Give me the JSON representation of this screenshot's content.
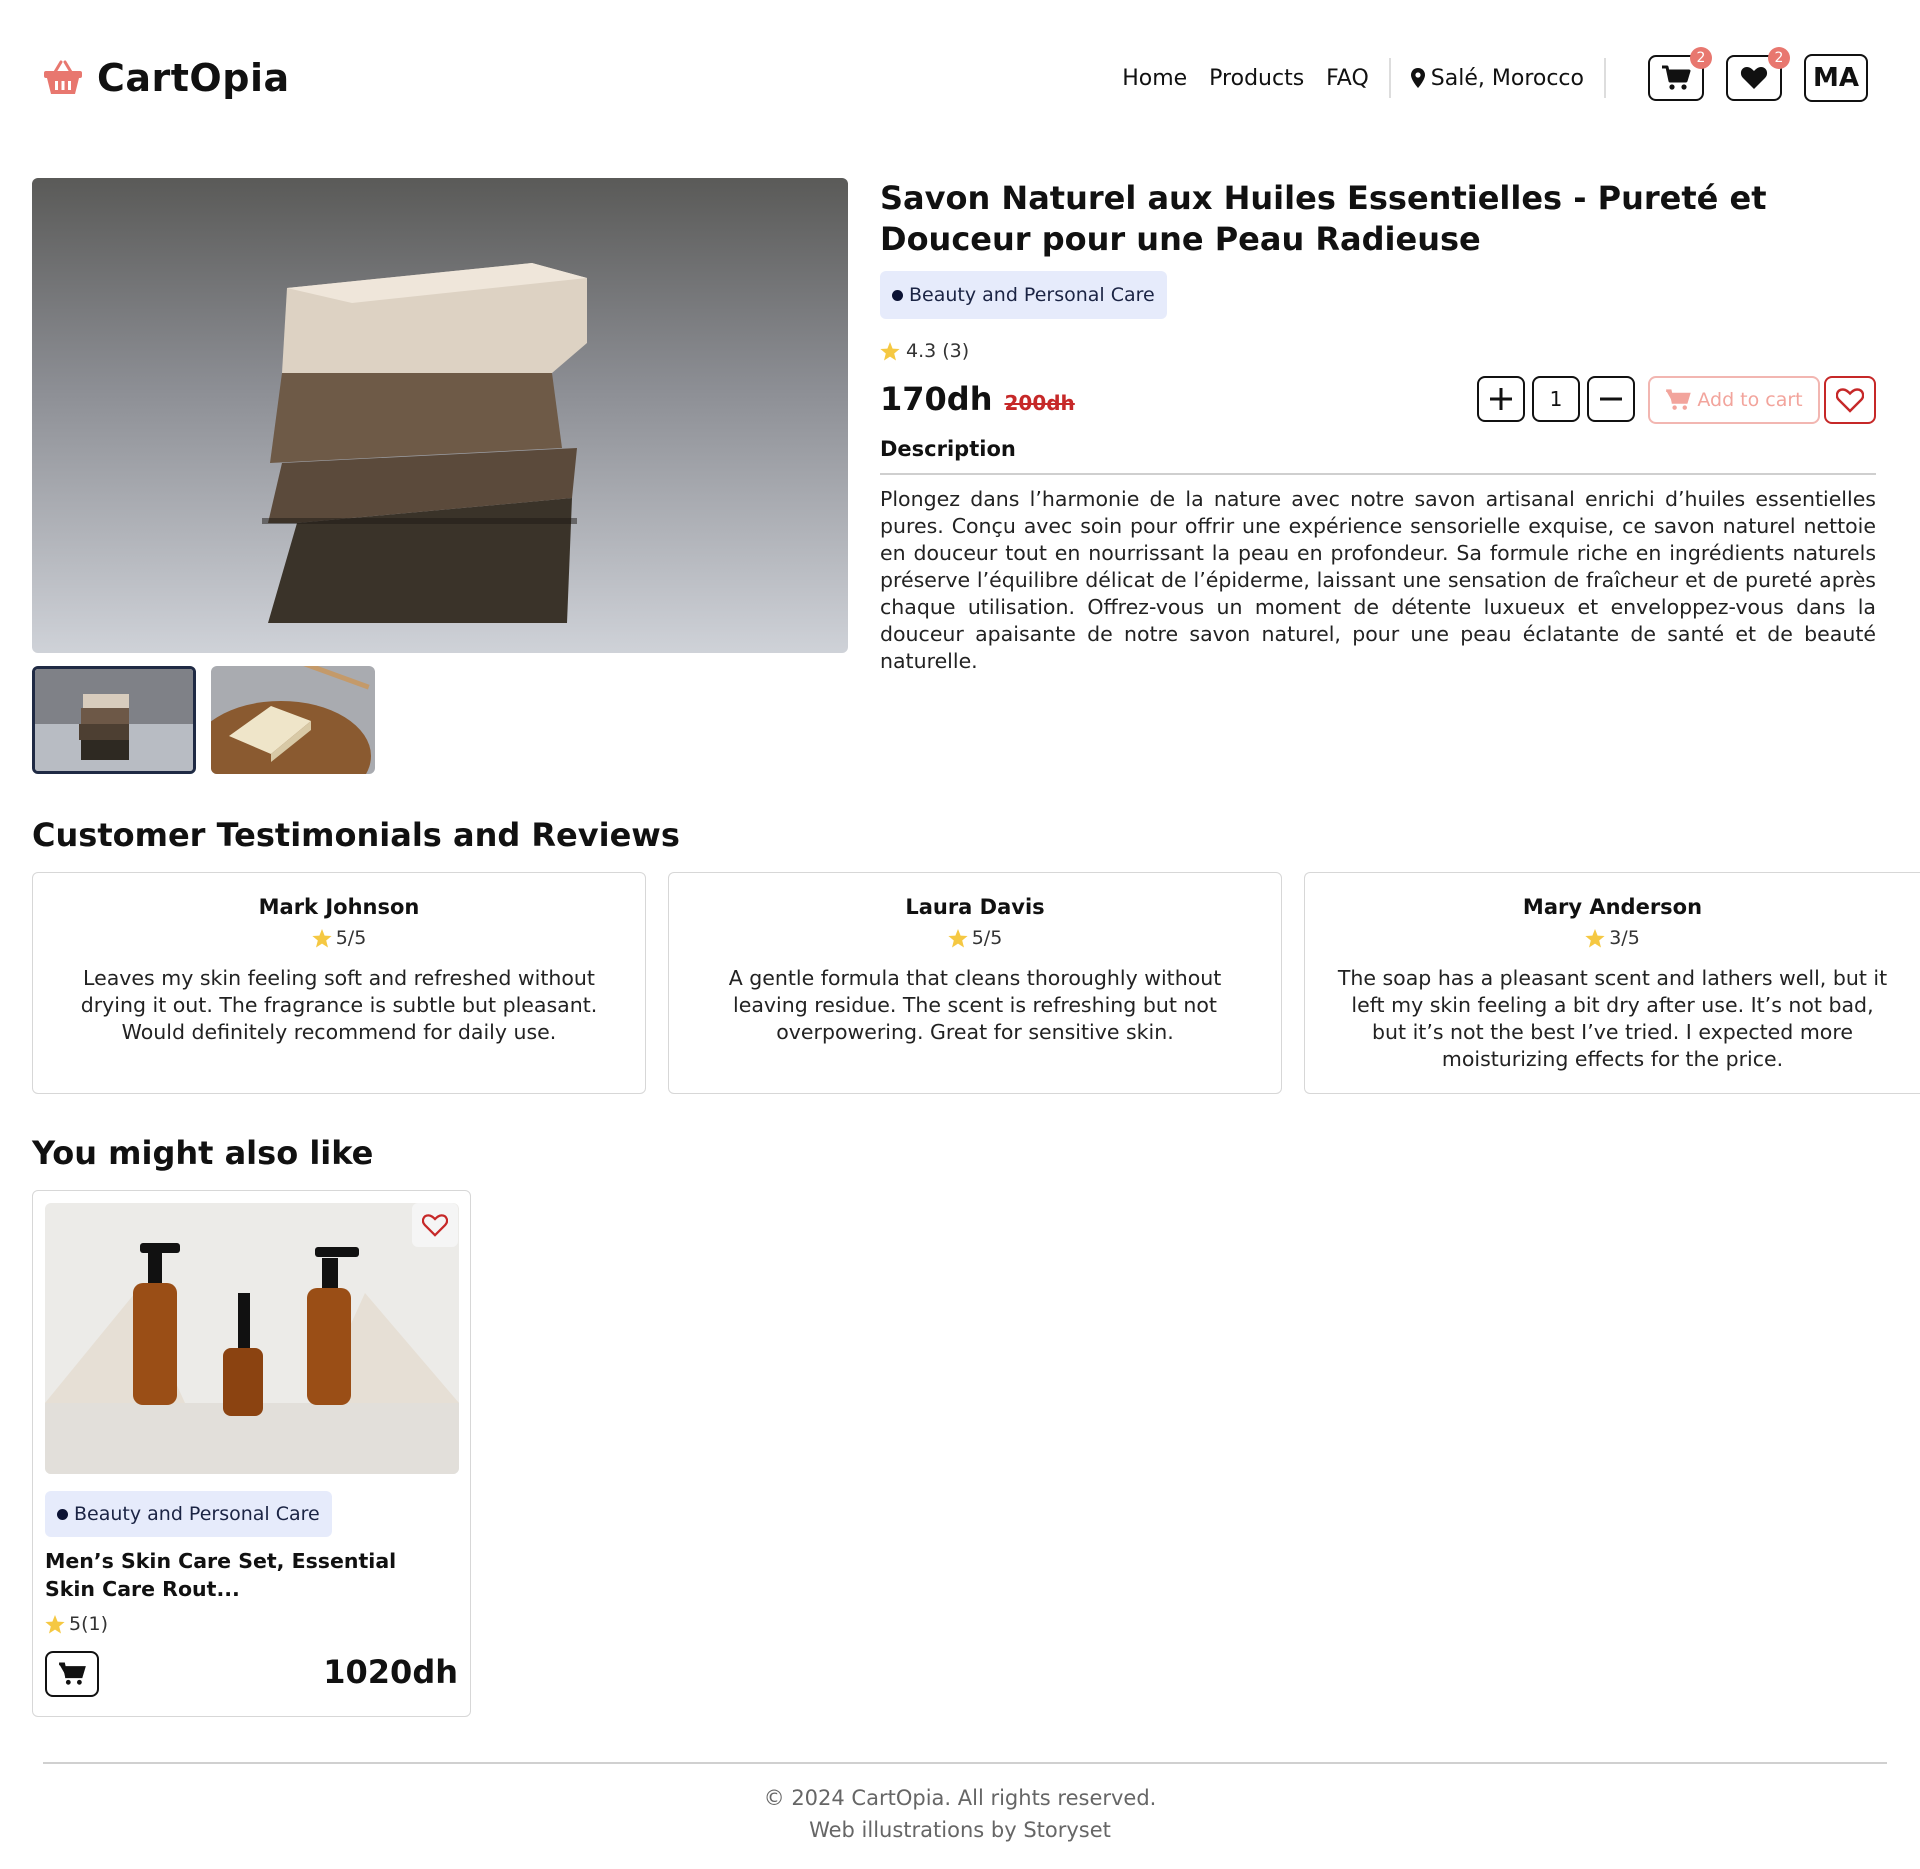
{
  "brand": {
    "name": "CartOpia",
    "logo_icon": "basket-icon",
    "accent": "#e8776f"
  },
  "nav": {
    "links": [
      "Home",
      "Products",
      "FAQ"
    ],
    "location": "Salé, Morocco",
    "cart_count": "2",
    "wishlist_count": "2",
    "user_initials": "MA"
  },
  "product": {
    "title": "Savon Naturel aux Huiles Essentielles - Pureté et Douceur pour une Peau Radieuse",
    "category": "Beauty and Personal Care",
    "rating": "4.3 (3)",
    "price": "170dh",
    "old_price": "200dh",
    "quantity": "1",
    "add_to_cart": "Add to cart",
    "description_label": "Description",
    "description": "Plongez dans l’harmonie de la nature avec notre savon artisanal enrichi d’huiles essentielles pures. Conçu avec soin pour offrir une expérience sensorielle exquise, ce savon naturel nettoie en douceur tout en nourrissant la peau en profondeur. Sa formule riche en ingrédients naturels préserve l’équilibre délicat de l’épiderme, laissant une sensation de fraîcheur et de pureté après chaque utilisation. Offrez-vous un moment de détente luxueux et enveloppez-vous dans la douceur apaisante de notre savon naturel, pour une peau éclatante de santé et de beauté naturelle."
  },
  "reviews": {
    "title": "Customer Testimonials and Reviews",
    "items": [
      {
        "name": "Mark Johnson",
        "score": "5/5",
        "text": "Leaves my skin feeling soft and refreshed without drying it out. The fragrance is subtle but pleasant. Would definitely recommend for daily use."
      },
      {
        "name": "Laura Davis",
        "score": "5/5",
        "text": "A gentle formula that cleans thoroughly without leaving residue. The scent is refreshing but not overpowering. Great for sensitive skin."
      },
      {
        "name": "Mary Anderson",
        "score": "3/5",
        "text": "The soap has a pleasant scent and lathers well, but it left my skin feeling a bit dry after use. It’s not bad, but it’s not the best I’ve tried. I expected more moisturizing effects for the price."
      }
    ]
  },
  "recommendations": {
    "title": "You might also like",
    "items": [
      {
        "category": "Beauty and Personal Care",
        "name": "Men’s Skin Care Set, Essential Skin Care Rout...",
        "rating": "5(1)",
        "price": "1020dh"
      }
    ]
  },
  "footer": {
    "copyright": "© 2024 CartOpia. All rights reserved.",
    "credit": "Web illustrations by Storyset"
  }
}
